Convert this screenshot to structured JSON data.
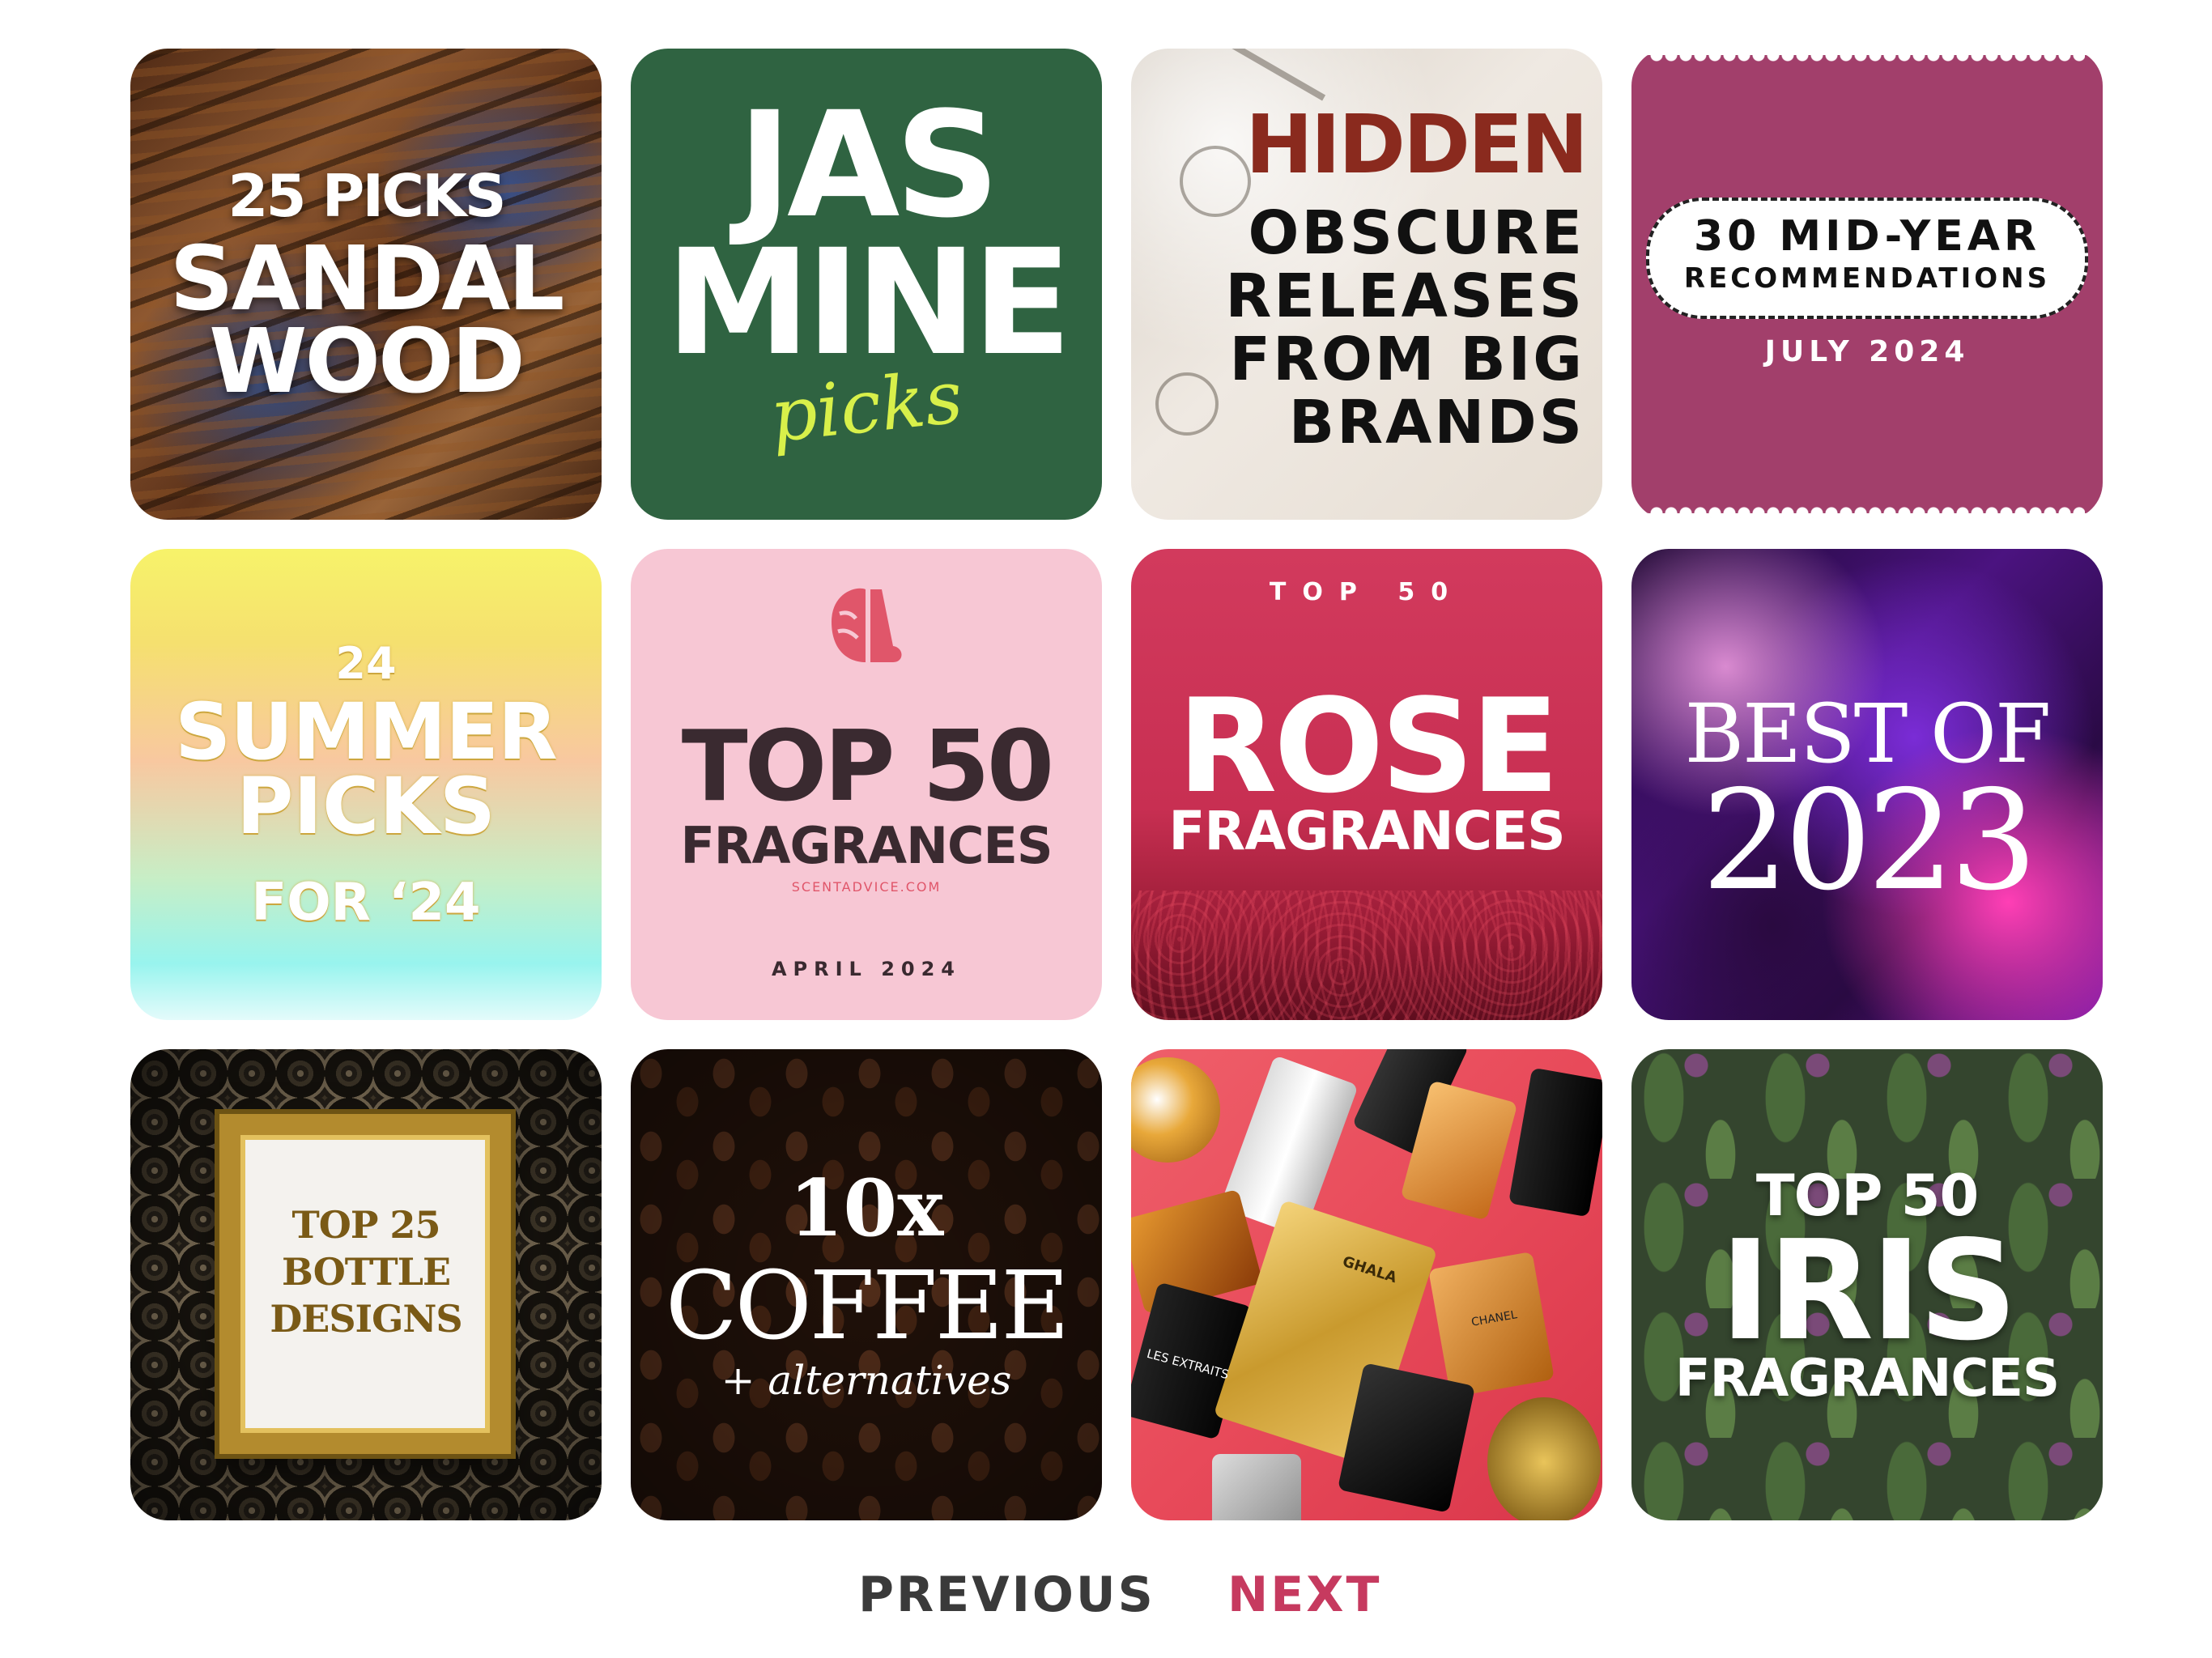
{
  "cards": [
    {
      "lines": [
        "25 PICKS",
        "SANDAL",
        "WOOD"
      ]
    },
    {
      "lines": [
        "JAS",
        "MINE",
        "picks"
      ]
    },
    {
      "lines": [
        "HIDDEN",
        "OBSCURE",
        "RELEASES",
        "FROM BIG",
        "BRANDS"
      ]
    },
    {
      "lines": [
        "30 MID-YEAR",
        "RECOMMENDATIONS",
        "JULY 2024"
      ]
    },
    {
      "lines": [
        "24",
        "SUMMER",
        "PICKS",
        "FOR ‘24"
      ]
    },
    {
      "lines": [
        "TOP 50",
        "FRAGRANCES",
        "SCENTADVICE.COM",
        "APRIL 2024"
      ]
    },
    {
      "lines": [
        "TOP 50",
        "ROSE",
        "FRAGRANCES"
      ]
    },
    {
      "lines": [
        "BEST OF",
        "2023"
      ]
    },
    {
      "lines": [
        "TOP 25",
        "BOTTLE",
        "DESIGNS"
      ]
    },
    {
      "lines": [
        "10x",
        "COFFEE",
        "+ alternatives"
      ]
    },
    {
      "lines": [
        "GHALA",
        "CHANEL",
        "LES EXTRAITS"
      ]
    },
    {
      "lines": [
        "TOP 50",
        "IRIS",
        "FRAGRANCES"
      ]
    }
  ],
  "pagination": {
    "previous": "PREVIOUS",
    "next": "NEXT"
  },
  "colors": {
    "next": "#c63a5f",
    "previous": "#3a3a3a",
    "rose_card": "#d23a5d",
    "jasmine_card": "#2f6341",
    "ticket_card": "#a23f6b",
    "pink_card": "#f7c7d4"
  },
  "icons": {
    "card6_logo": "brain-nose-icon"
  }
}
